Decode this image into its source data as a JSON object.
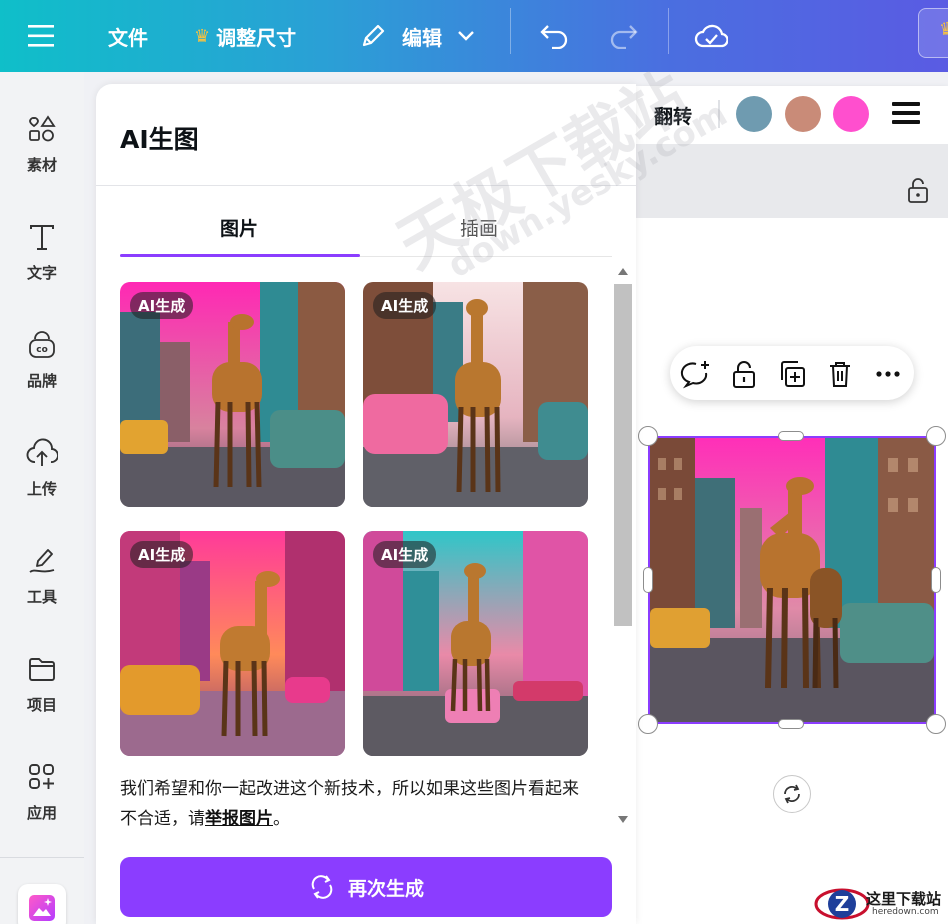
{
  "topbar": {
    "file": "文件",
    "resize": "调整尺寸",
    "edit": "编辑"
  },
  "rail": {
    "items": [
      {
        "label": "素材",
        "icon": "elements-icon"
      },
      {
        "label": "文字",
        "icon": "text-icon"
      },
      {
        "label": "品牌",
        "icon": "brand-icon"
      },
      {
        "label": "上传",
        "icon": "upload-cloud-icon"
      },
      {
        "label": "工具",
        "icon": "draw-tool-icon"
      },
      {
        "label": "项目",
        "icon": "folder-icon"
      },
      {
        "label": "应用",
        "icon": "apps-icon"
      }
    ]
  },
  "panel": {
    "title": "AI生图",
    "tabs": [
      {
        "label": "图片",
        "active": true
      },
      {
        "label": "插画",
        "active": false
      }
    ],
    "badge": "AI生成",
    "note_prefix": "我们希望和你一起改进这个新技术，所以如果这些图片看起来不合适，请",
    "note_link": "举报图片",
    "note_suffix": "。",
    "regenerate": "再次生成"
  },
  "context_toolbar": {
    "flip": "翻转",
    "swatches": [
      "#6f9bb0",
      "#c98b78",
      "#ff4fce"
    ]
  },
  "colors": {
    "accent": "#8b3dff"
  },
  "watermark": {
    "site_text": "这里下载站",
    "site_url": "heredown.com",
    "diagonal_cn": "天极下载站",
    "diagonal_en": "down.yesky.com"
  }
}
